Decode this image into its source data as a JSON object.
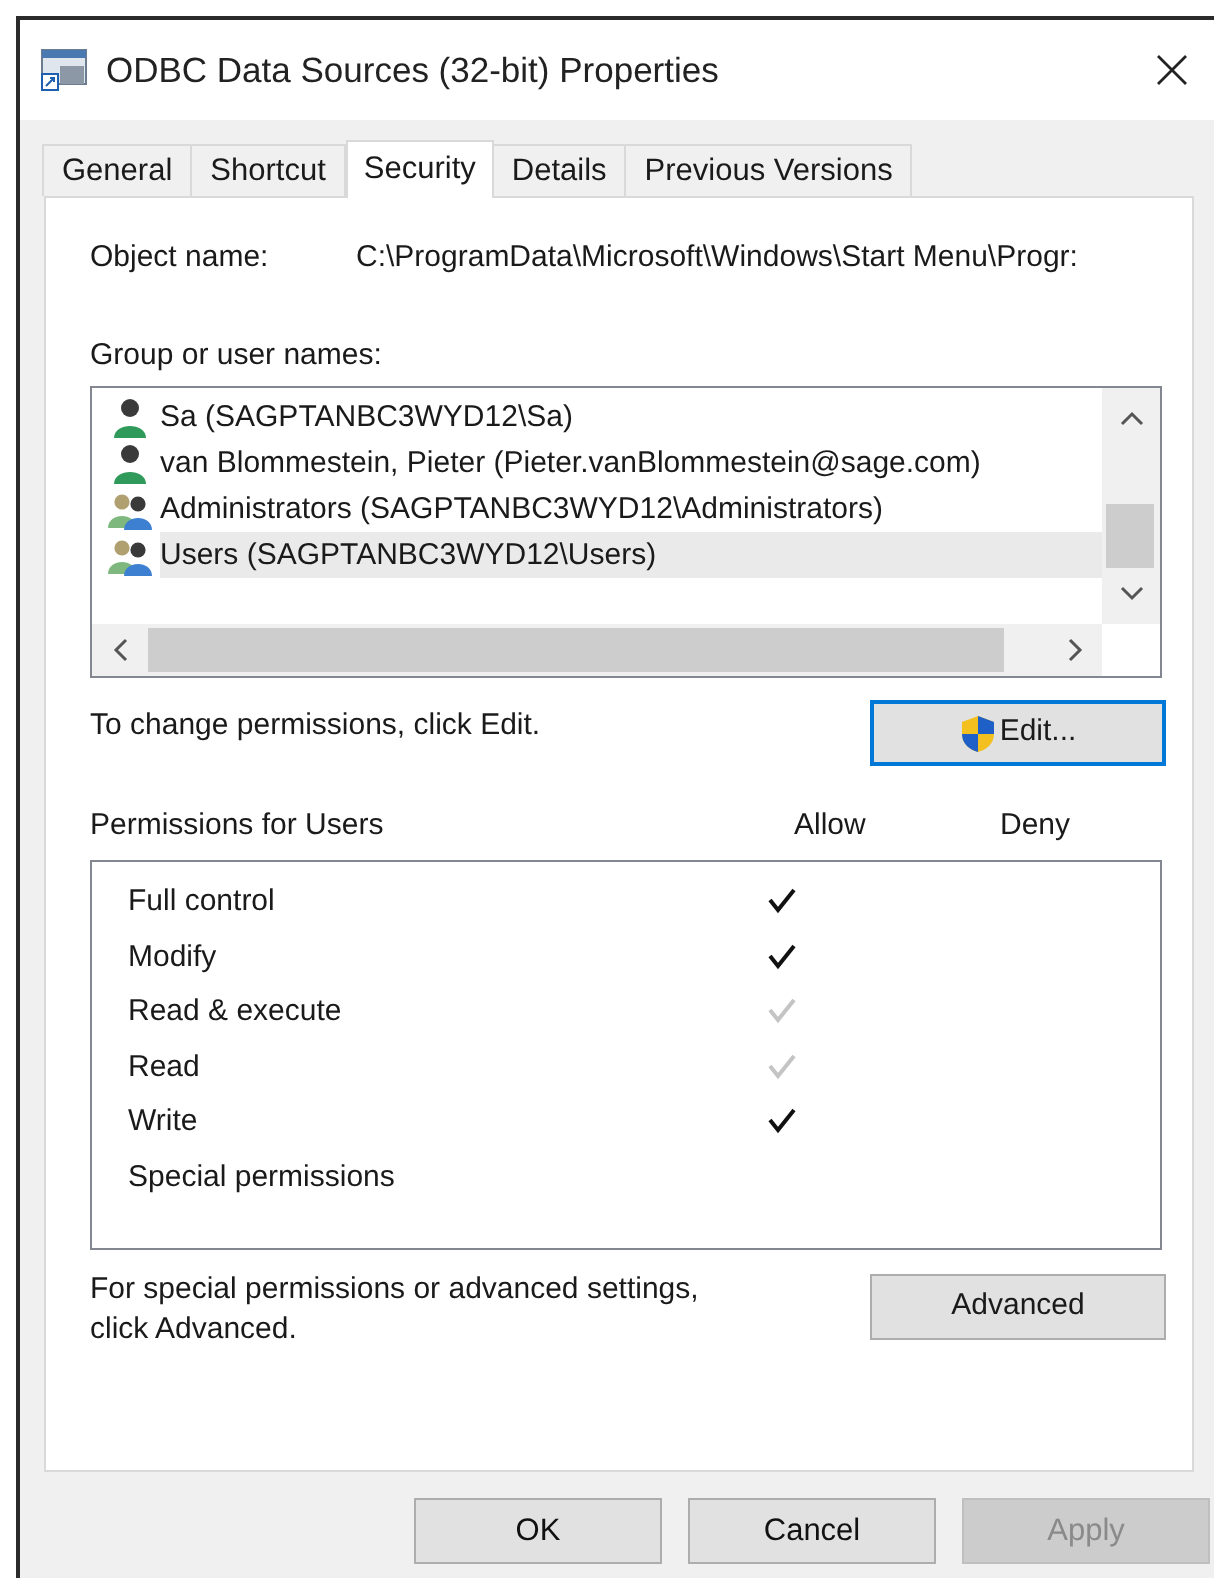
{
  "window": {
    "title": "ODBC Data Sources (32-bit) Properties"
  },
  "tabs": [
    {
      "label": "General",
      "selected": false
    },
    {
      "label": "Shortcut",
      "selected": false
    },
    {
      "label": "Security",
      "selected": true
    },
    {
      "label": "Details",
      "selected": false
    },
    {
      "label": "Previous Versions",
      "selected": false
    }
  ],
  "object_name": {
    "label": "Object name:",
    "value": "C:\\ProgramData\\Microsoft\\Windows\\Start Menu\\Progr:"
  },
  "group_list": {
    "label": "Group or user names:",
    "items": [
      {
        "kind": "user",
        "name": "Sa (SAGPTANBC3WYD12\\Sa)",
        "selected": false
      },
      {
        "kind": "user",
        "name": "van Blommestein, Pieter (Pieter.vanBlommestein@sage.com)",
        "selected": false
      },
      {
        "kind": "group",
        "name": "Administrators (SAGPTANBC3WYD12\\Administrators)",
        "selected": false
      },
      {
        "kind": "group",
        "name": "Users (SAGPTANBC3WYD12\\Users)",
        "selected": true
      }
    ]
  },
  "edit_hint": "To change permissions, click Edit.",
  "edit_button": "Edit...",
  "permissions": {
    "title": "Permissions for Users",
    "allow_header": "Allow",
    "deny_header": "Deny",
    "rows": [
      {
        "name": "Full control",
        "allow": true,
        "inherited": false,
        "deny": false
      },
      {
        "name": "Modify",
        "allow": true,
        "inherited": false,
        "deny": false
      },
      {
        "name": "Read & execute",
        "allow": true,
        "inherited": true,
        "deny": false
      },
      {
        "name": "Read",
        "allow": true,
        "inherited": true,
        "deny": false
      },
      {
        "name": "Write",
        "allow": true,
        "inherited": false,
        "deny": false
      },
      {
        "name": "Special permissions",
        "allow": false,
        "deny": false
      }
    ]
  },
  "advanced_hint": "For special permissions or advanced settings, click Advanced.",
  "advanced_button": "Advanced",
  "buttons": [
    {
      "label": "OK",
      "disabled": false
    },
    {
      "label": "Cancel",
      "disabled": false
    },
    {
      "label": "Apply",
      "disabled": true
    }
  ]
}
